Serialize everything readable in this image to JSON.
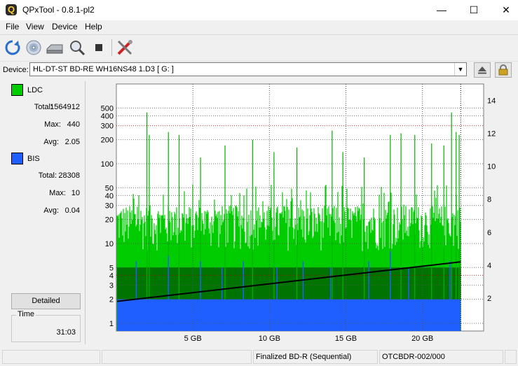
{
  "window": {
    "title": "QPxTool - 0.8.1-pl2",
    "minimize_glyph": "—",
    "maximize_glyph": "☐",
    "close_glyph": "✕"
  },
  "menu": [
    "File",
    "View",
    "Device",
    "Help"
  ],
  "toolbar": {
    "icons": [
      "refresh-icon",
      "disc-icon",
      "drive-icon",
      "zoom-icon",
      "stop-icon",
      "settings-tools-icon"
    ]
  },
  "device": {
    "label": "Device:",
    "selected": "HL-DT-ST BD-RE  WH16NS48  1.D3 [ G: ]"
  },
  "legend": {
    "ldc": {
      "name": "LDC",
      "color": "#00cc00",
      "total_label": "Total:",
      "total": "1564912",
      "max_label": "Max:",
      "max": "440",
      "avg_label": "Avg:",
      "avg": "2.05"
    },
    "bis": {
      "name": "BIS",
      "color": "#1f5fff",
      "total_label": "Total:",
      "total": "28308",
      "max_label": "Max:",
      "max": "10",
      "avg_label": "Avg:",
      "avg": "0.04"
    }
  },
  "buttons": {
    "detailed": "Detailed"
  },
  "time": {
    "label": "Time",
    "value": "31:03"
  },
  "status": {
    "cell1": "",
    "cell2": "",
    "disc_type": "Finalized BD-R (Sequential)",
    "media_id": "OTCBDR-002/000",
    "cell5": ""
  },
  "chart_data": {
    "type": "area",
    "x_unit": "GB",
    "x_ticks": [
      5,
      10,
      15,
      20
    ],
    "x_tick_labels": [
      "5 GB",
      "10 GB",
      "15 GB",
      "20 GB"
    ],
    "xlim": [
      0,
      24
    ],
    "data_end_gb": 22.5,
    "y_left_scale": "log",
    "y_left_ticks": [
      1,
      2,
      3,
      4,
      5,
      10,
      20,
      30,
      40,
      50,
      100,
      200,
      300,
      400,
      500
    ],
    "ylim_left": [
      0.8,
      1000
    ],
    "y_right_ticks": [
      2,
      4,
      6,
      8,
      10,
      12,
      14
    ],
    "ylim_right": [
      0,
      15
    ],
    "series": [
      {
        "name": "LDC",
        "color": "#00cc00",
        "typical_range": [
          8,
          30
        ],
        "max": 440,
        "avg": 2.05
      },
      {
        "name": "BIS",
        "color": "#1f5fff",
        "typical_range": [
          1,
          2
        ],
        "max": 10,
        "avg": 0.04
      }
    ],
    "speed_line": {
      "color": "#000000",
      "start": 1.8,
      "end": 4.2
    },
    "ldc_peaks": [
      [
        2.0,
        440
      ],
      [
        2.15,
        230
      ],
      [
        3.4,
        250
      ],
      [
        4.1,
        230
      ],
      [
        5.5,
        120
      ],
      [
        7.1,
        170
      ],
      [
        8.9,
        200
      ],
      [
        10.3,
        140
      ],
      [
        11.8,
        160
      ],
      [
        14.1,
        260
      ],
      [
        14.8,
        140
      ],
      [
        16.2,
        120
      ],
      [
        17.9,
        230
      ],
      [
        18.6,
        240
      ],
      [
        19.5,
        230
      ],
      [
        20.6,
        180
      ],
      [
        21.4,
        170
      ],
      [
        21.9,
        440
      ],
      [
        22.2,
        250
      ],
      [
        22.4,
        230
      ]
    ],
    "bis_peaks": [
      [
        1.3,
        6
      ],
      [
        3.4,
        7
      ],
      [
        5.5,
        6
      ],
      [
        6.9,
        5
      ],
      [
        8.3,
        6
      ],
      [
        10.5,
        5
      ],
      [
        12.2,
        6
      ],
      [
        14.0,
        5
      ],
      [
        16.5,
        6
      ],
      [
        17.9,
        8
      ],
      [
        19.1,
        5
      ],
      [
        21.8,
        6
      ]
    ]
  }
}
